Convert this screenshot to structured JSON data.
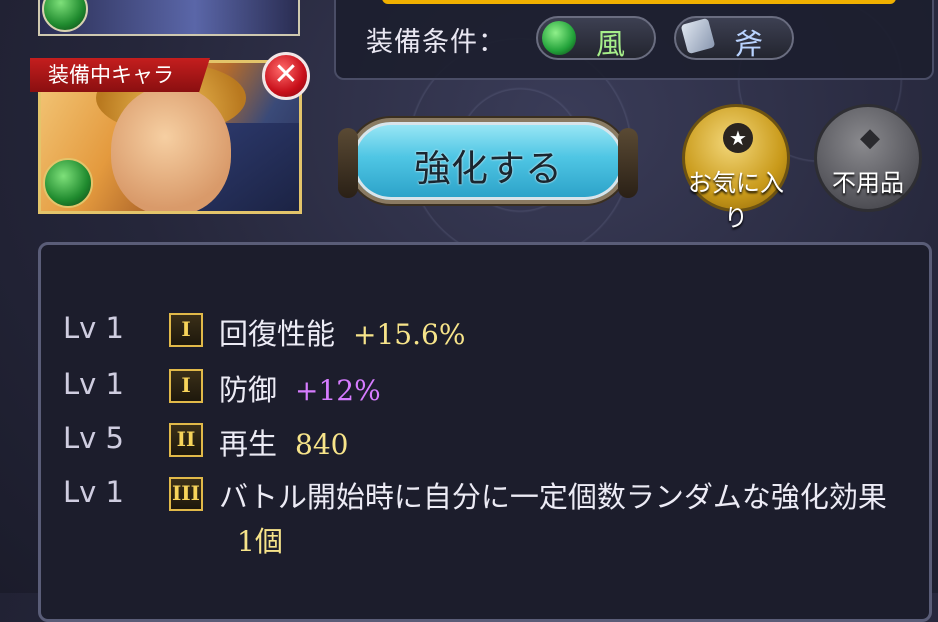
{
  "equip_condition": {
    "label": "装備条件：",
    "element": {
      "icon": "wind-element-icon",
      "text": "風"
    },
    "weapon_type": {
      "icon": "axe-icon",
      "text": "斧"
    }
  },
  "character": {
    "tag": "装備中キャラ",
    "remove_symbol": "✕"
  },
  "actions": {
    "enhance_label": "強化する",
    "favorite_label": "お気に入り",
    "favorite_icon": "★",
    "unused_label": "不用品",
    "unused_icon": "◆"
  },
  "skills": [
    {
      "lv": "Lv 1",
      "rank": "I",
      "name": "回復性能",
      "value": "+15.6%",
      "value_color": "#f7e48a"
    },
    {
      "lv": "Lv 1",
      "rank": "I",
      "name": "防御",
      "value": "+12%",
      "value_color": "#d67cff"
    },
    {
      "lv": "Lv 5",
      "rank": "II",
      "name": "再生",
      "value": "840",
      "value_color": "#f7e48a"
    },
    {
      "lv": "Lv 1",
      "rank": "III",
      "name": "バトル開始時に自分に一定個数ランダムな強化効果",
      "value": "1個",
      "value_color": "#f7e48a"
    }
  ],
  "colors": {
    "gold_bar": "#f0b000",
    "remove": "#c80f1a",
    "enhance": "#4fc6e4",
    "favorite": "#c99a1a"
  }
}
